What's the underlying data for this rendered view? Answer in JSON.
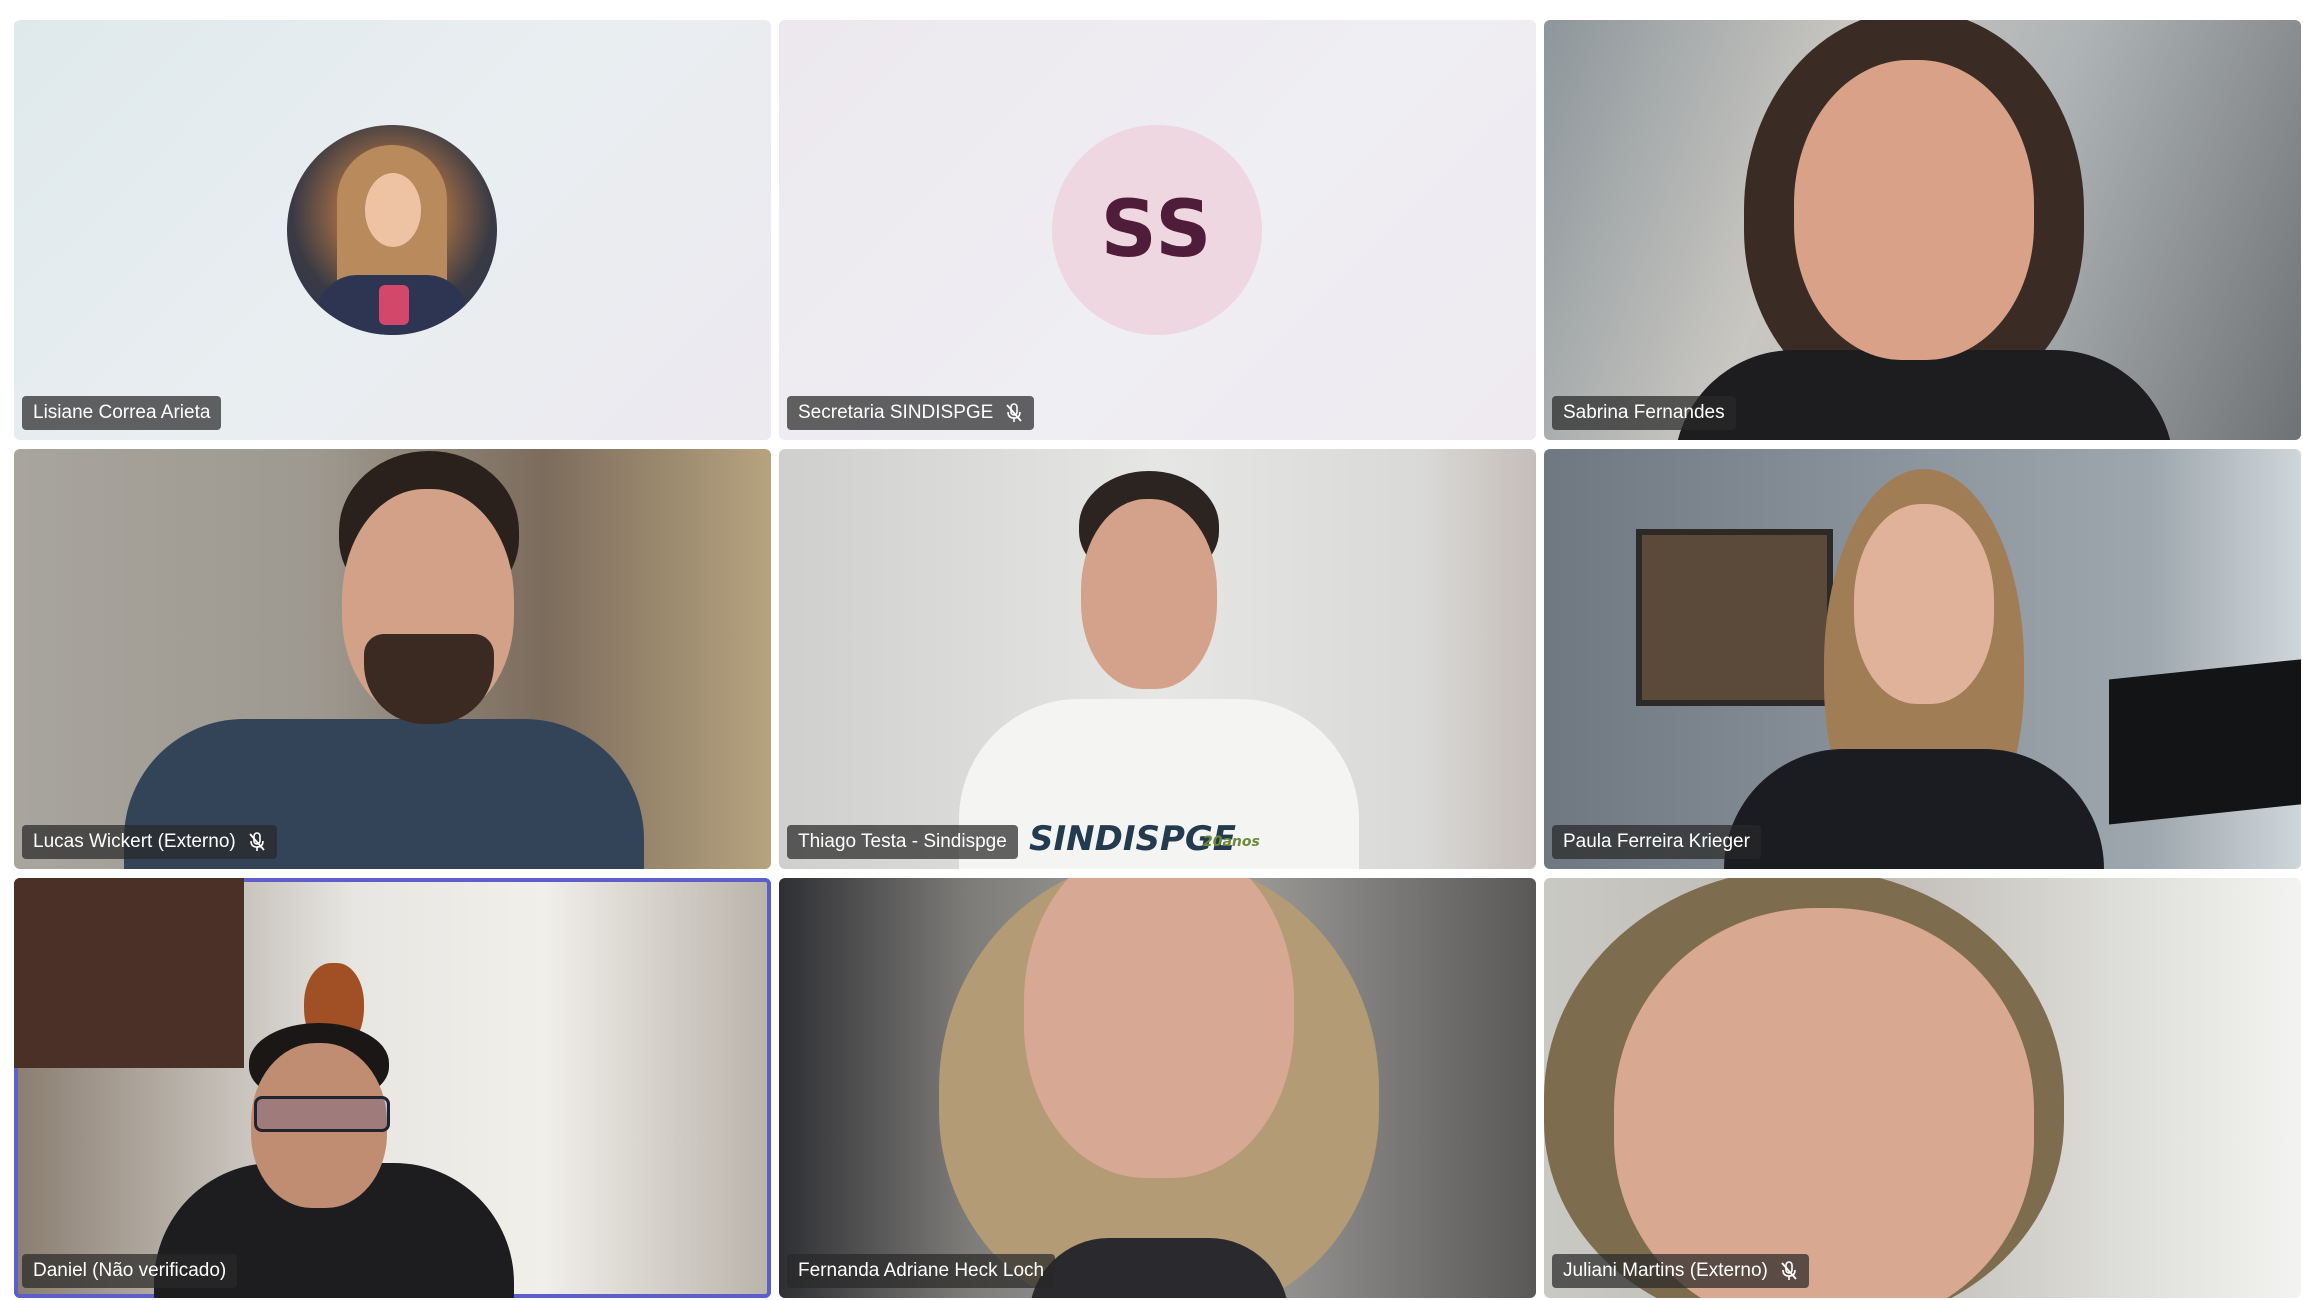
{
  "participants": [
    {
      "name": "Lisiane Correa Arieta",
      "muted": false,
      "tile": "avatar-photo"
    },
    {
      "name": "Secretaria SINDISPGE",
      "muted": true,
      "tile": "avatar-initials",
      "initials": "SS"
    },
    {
      "name": "Sabrina Fernandes",
      "muted": false,
      "tile": "video"
    },
    {
      "name": "Lucas Wickert (Externo)",
      "muted": true,
      "tile": "video"
    },
    {
      "name": "Thiago Testa - Sindispge",
      "muted": false,
      "tile": "video",
      "shirt_text": "SINDISPGE",
      "shirt_badge": "20anos"
    },
    {
      "name": "Paula Ferreira Krieger",
      "muted": false,
      "tile": "video"
    },
    {
      "name": "Daniel (Não verificado)",
      "muted": false,
      "tile": "video",
      "active_speaker": true
    },
    {
      "name": "Fernanda Adriane Heck Loch",
      "muted": false,
      "tile": "video"
    },
    {
      "name": "Juliani Martins (Externo)",
      "muted": true,
      "tile": "video"
    }
  ],
  "icons": {
    "mute": "microphone-off-icon"
  },
  "colors": {
    "active_border": "#5b5fc7",
    "initials_bg": "#eed7e0",
    "initials_text": "#4f1d3a",
    "label_bg": "#282828"
  }
}
